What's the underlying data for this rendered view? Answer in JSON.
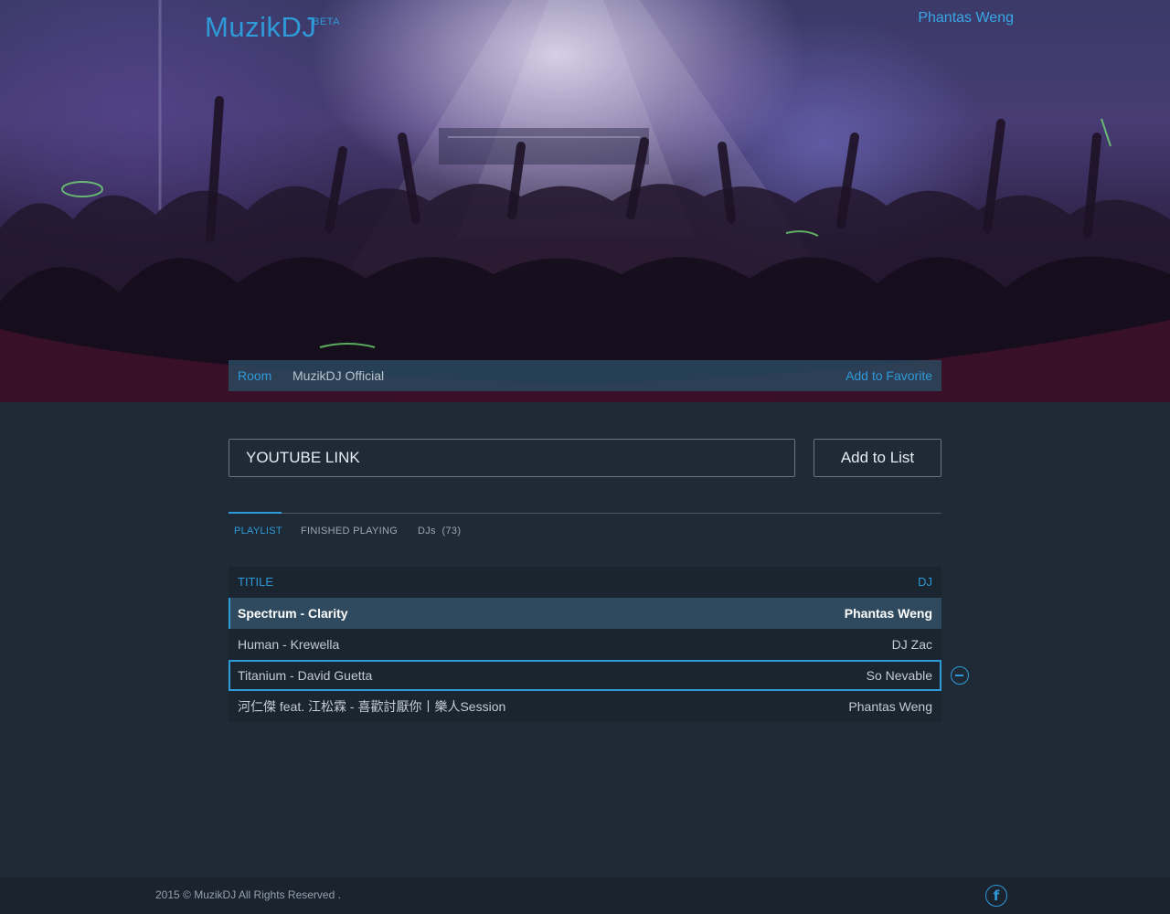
{
  "header": {
    "brand": "MuzikDJ",
    "badge": "BETA",
    "user_name": "Phantas Weng"
  },
  "room": {
    "label": "Room",
    "name": "MuzikDJ Official",
    "favorite_label": "Add to Favorite"
  },
  "add_form": {
    "placeholder": "YOUTUBE LINK",
    "button_label": "Add to List"
  },
  "tabs": [
    {
      "label": "PLAYLIST",
      "active": true
    },
    {
      "label": "FINISHED PLAYING",
      "active": false
    },
    {
      "label": "DJs  (73)",
      "active": false
    }
  ],
  "playlist": {
    "columns": {
      "title": "TITILE",
      "dj": "DJ"
    },
    "rows": [
      {
        "title": "Spectrum - Clarity",
        "dj": "Phantas Weng",
        "state": "playing"
      },
      {
        "title": "Human - Krewella",
        "dj": "DJ Zac",
        "state": "normal"
      },
      {
        "title": "Titanium - David Guetta",
        "dj": "So Nevable",
        "state": "selected"
      },
      {
        "title": "河仁傑 feat. 江松霖 - 喜歡討厭你丨樂人Session",
        "dj": "Phantas Weng",
        "state": "normal"
      }
    ]
  },
  "footer": {
    "copyright": "2015 © MuzikDJ All Rights Reserved .",
    "social_icon": "facebook-icon"
  },
  "colors": {
    "accent": "#2f9ad8",
    "background": "#1f2a37"
  }
}
